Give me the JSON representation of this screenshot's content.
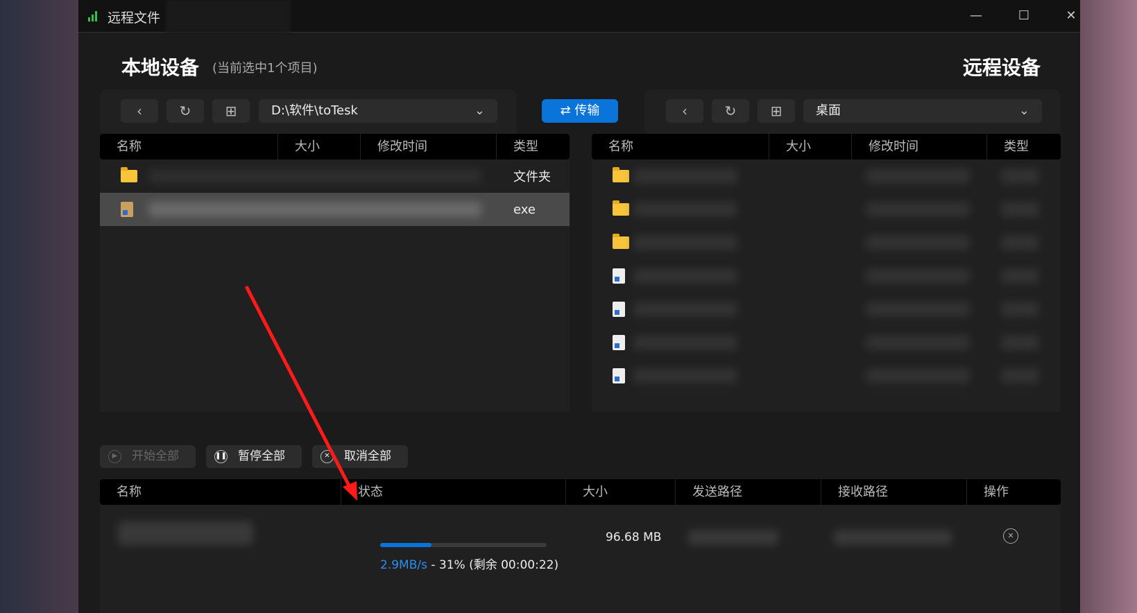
{
  "window": {
    "title": "远程文件",
    "minimize": "—",
    "maximize": "☐",
    "close": "✕"
  },
  "local": {
    "title": "本地设备",
    "selection": "(当前选中1个项目)",
    "path": "D:\\软件\\toTesk",
    "columns": [
      "名称",
      "大小",
      "修改时间",
      "类型"
    ],
    "rows": [
      {
        "icon": "folder-icon",
        "type": "文件夹"
      },
      {
        "icon": "exe-icon",
        "type": "exe",
        "selected": true
      }
    ]
  },
  "transfer_button": "传输",
  "remote": {
    "title": "远程设备",
    "path": "桌面",
    "columns": [
      "名称",
      "大小",
      "修改时间",
      "类型"
    ],
    "rows": [
      "folder",
      "folder",
      "folder",
      "file",
      "file",
      "file",
      "file"
    ]
  },
  "actions": {
    "start_all": "开始全部",
    "pause_all": "暂停全部",
    "cancel_all": "取消全部"
  },
  "queue": {
    "columns": [
      "名称",
      "状态",
      "大小",
      "发送路径",
      "接收路径",
      "操作"
    ],
    "rows": [
      {
        "progress_percent": 31,
        "speed": "2.9MB/s",
        "status": " - 31% (剩余 00:00:22)",
        "size": "96.68 MB"
      }
    ]
  },
  "colors": {
    "accent": "#0a74da",
    "annotation": "#ff1a1a"
  }
}
